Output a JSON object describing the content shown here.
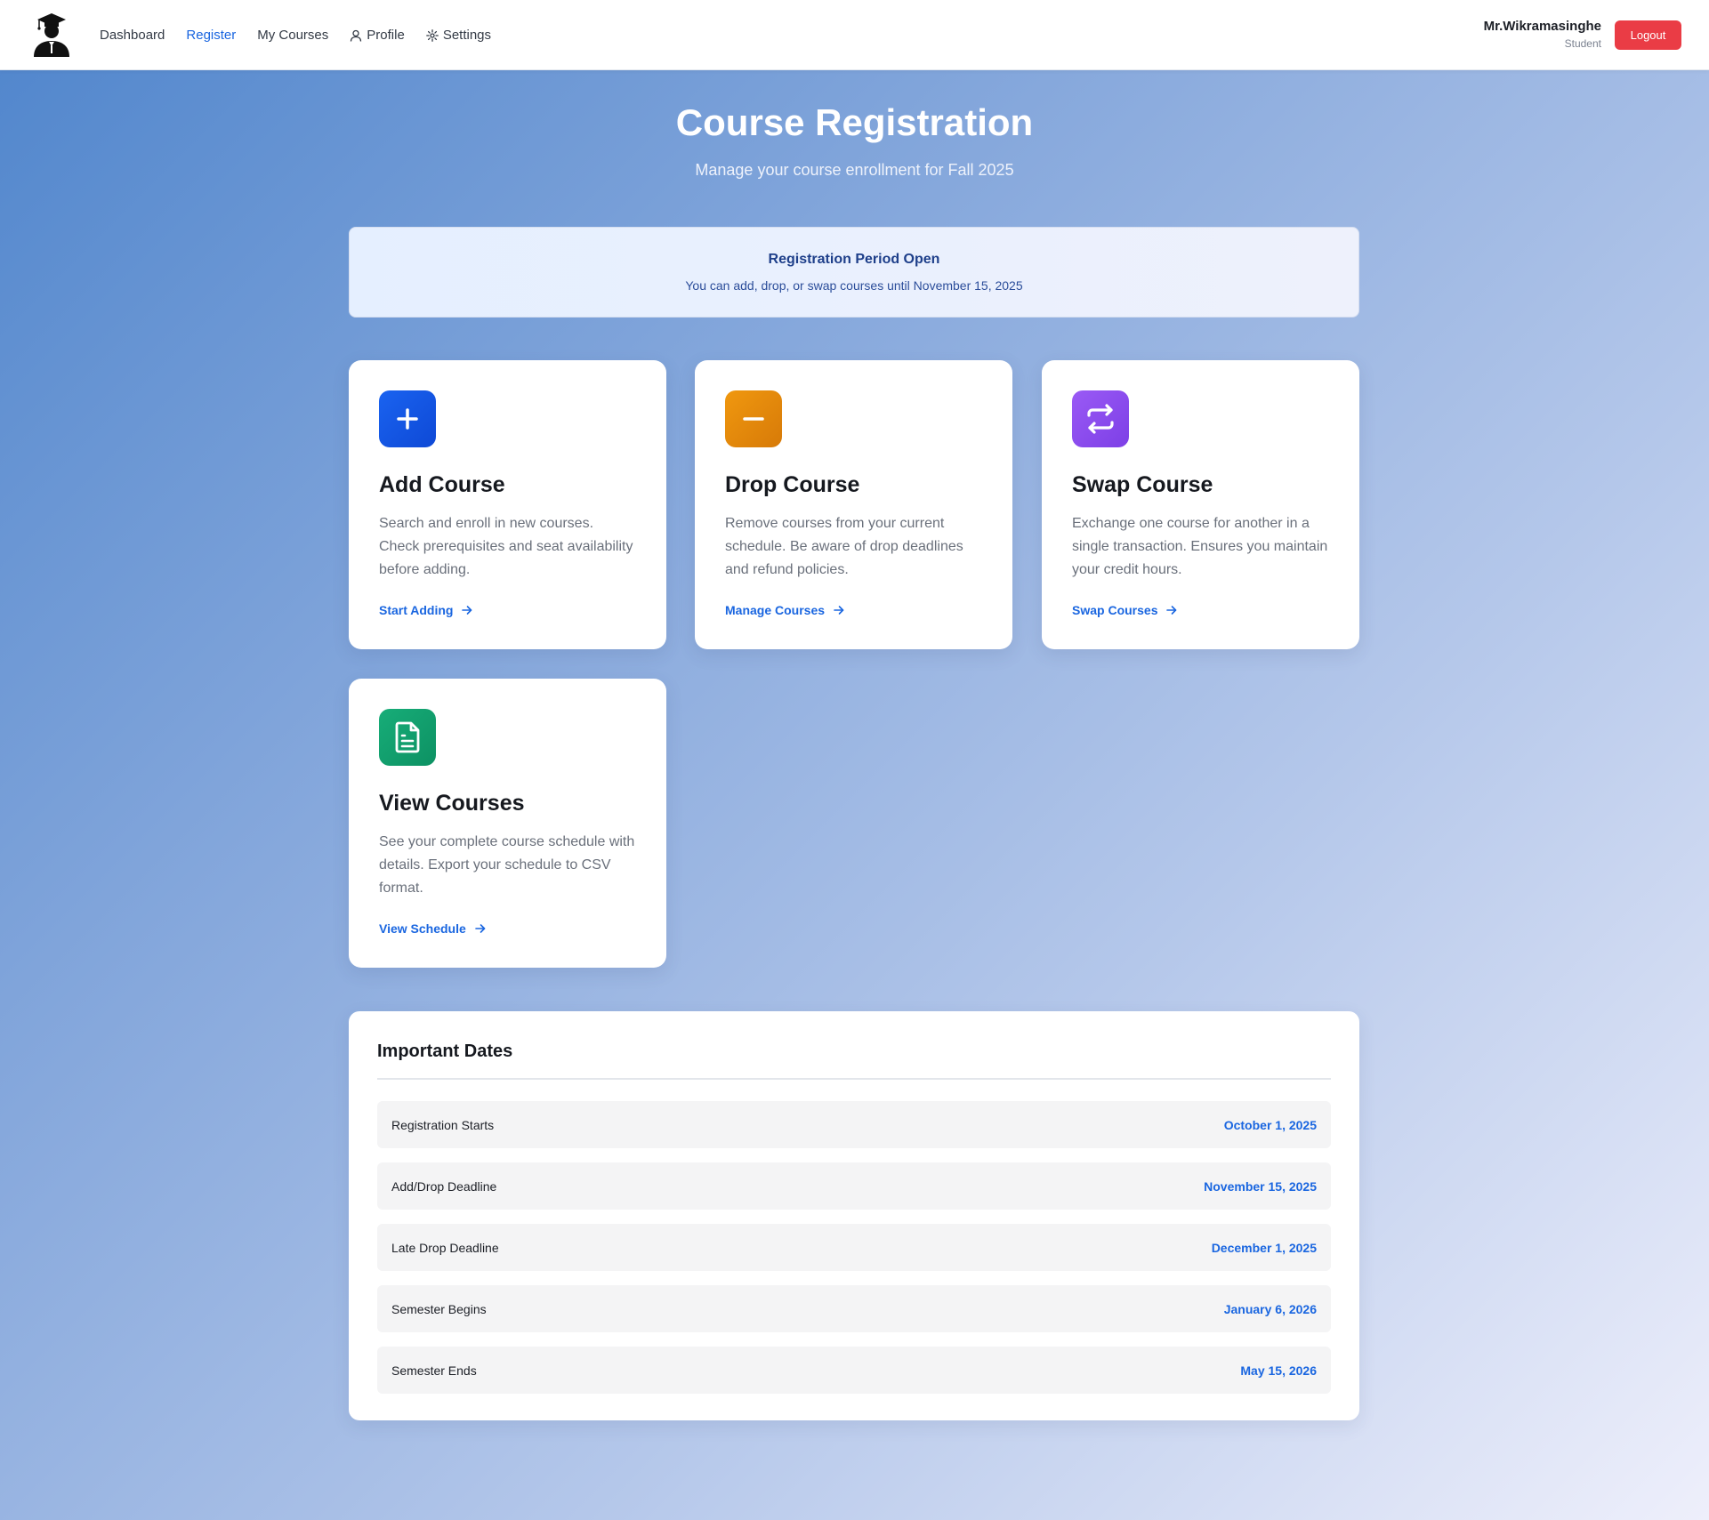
{
  "nav": {
    "links": [
      {
        "label": "Dashboard"
      },
      {
        "label": "Register"
      },
      {
        "label": "My Courses"
      },
      {
        "label": "Profile",
        "icon": "user-icon"
      },
      {
        "label": "Settings",
        "icon": "gear-icon"
      }
    ],
    "active": "Register",
    "accent_color": "#1a66e0"
  },
  "user": {
    "name": "Mr.Wikramasinghe",
    "role": "Student",
    "logout_label": "Logout",
    "logout_color": "#ea3c45"
  },
  "hero": {
    "title": "Course Registration",
    "subtitle": "Manage your course enrollment for Fall 2025"
  },
  "banner": {
    "title": "Registration Period Open",
    "text": "You can add, drop, or swap courses until November 15, 2025"
  },
  "cards": [
    {
      "title": "Add Course",
      "description": "Search and enroll in new courses. Check prerequisites and seat availability before adding.",
      "link": "Start Adding",
      "icon": "plus-icon",
      "color": "#1557e6"
    },
    {
      "title": "Drop Course",
      "description": "Remove courses from your current schedule. Be aware of drop deadlines and refund policies.",
      "link": "Manage Courses",
      "icon": "minus-icon",
      "color": "#e38a0b"
    },
    {
      "title": "Swap Course",
      "description": "Exchange one course for another in a single transaction. Ensures you maintain your credit hours.",
      "link": "Swap Courses",
      "icon": "swap-icon",
      "color": "#8b4ef0"
    },
    {
      "title": "View Courses",
      "description": "See your complete course schedule with details. Export your schedule to CSV format.",
      "link": "View Schedule",
      "icon": "document-icon",
      "color": "#13a06e"
    }
  ],
  "dates": {
    "title": "Important Dates",
    "rows": [
      {
        "label": "Registration Starts",
        "date": "October 1, 2025"
      },
      {
        "label": "Add/Drop Deadline",
        "date": "November 15, 2025"
      },
      {
        "label": "Late Drop Deadline",
        "date": "December 1, 2025"
      },
      {
        "label": "Semester Begins",
        "date": "January 6, 2026"
      },
      {
        "label": "Semester Ends",
        "date": "May 15, 2026"
      }
    ]
  }
}
